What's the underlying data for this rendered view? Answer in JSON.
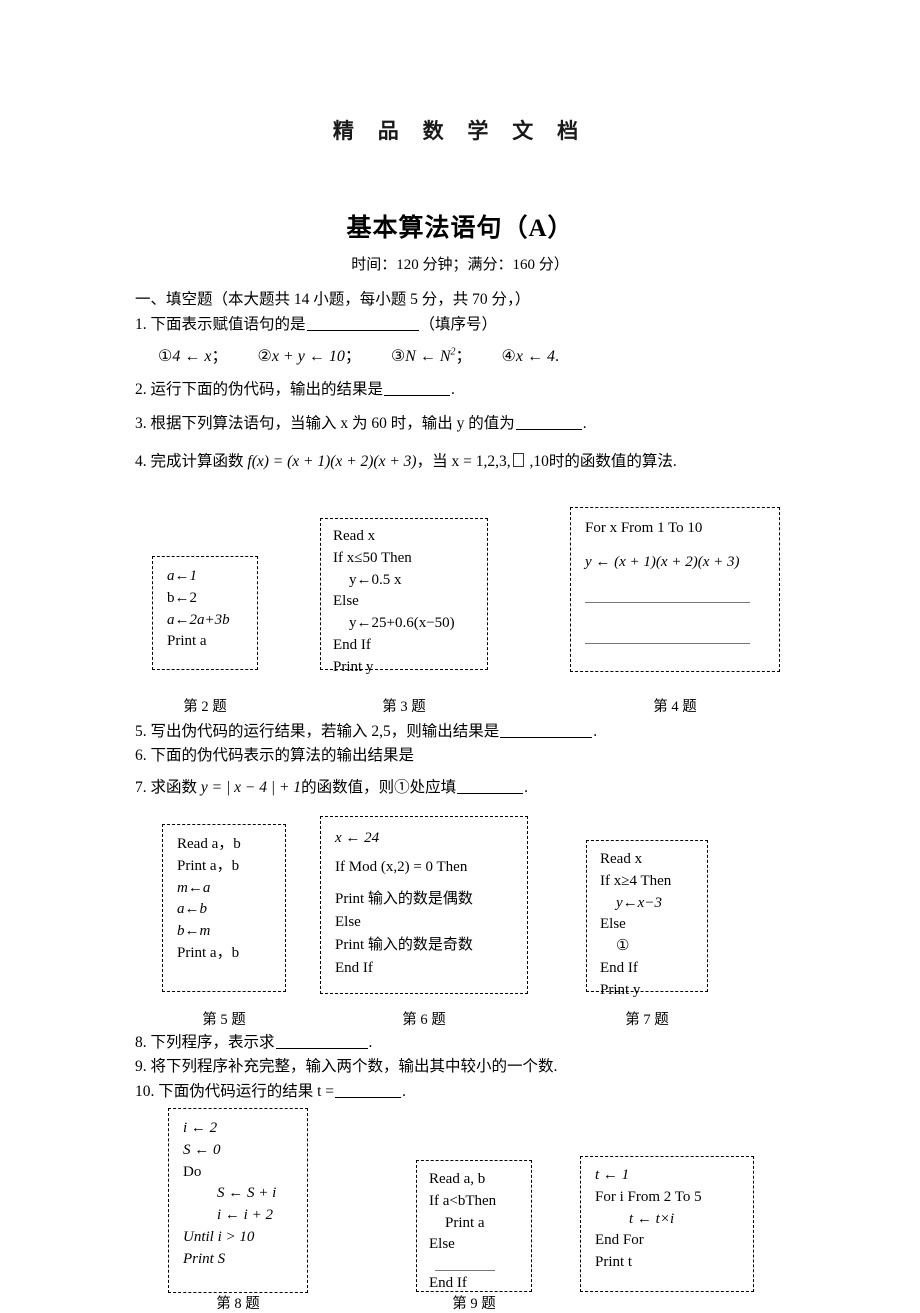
{
  "header": {
    "watermark": "精 品 数 学 文 档"
  },
  "title": {
    "main": "基本算法语句（A）",
    "subtitle": "时间：120 分钟；满分：160 分）"
  },
  "section": {
    "heading": "一、填空题（本大题共 14 小题，每小题 5 分，共 70 分，）"
  },
  "questions": {
    "q1": {
      "text": "1. 下面表示赋值语句的是",
      "suffix": "（填序号）",
      "options": [
        {
          "marker": "①",
          "expr": "4 ← x",
          "tail": "；"
        },
        {
          "marker": "②",
          "expr": "x + y ← 10",
          "tail": "；"
        },
        {
          "marker": "③",
          "expr": "N ← N",
          "sup": "2",
          "tail": "；"
        },
        {
          "marker": "④",
          "expr": "x ← 4",
          "tail": "."
        }
      ]
    },
    "q2": {
      "text": "2. 运行下面的伪代码，输出的结果是",
      "tail": "."
    },
    "q3": {
      "text": "3. 根据下列算法语句，当输入 x 为 60 时，输出 y 的值为",
      "tail": "."
    },
    "q4": {
      "prefix": "4. 完成计算函数 ",
      "func": "f(x) = (x + 1)(x + 2)(x + 3)",
      "mid": "，当 x = 1,2,3,",
      "tail": " ,10时的函数值的算法."
    },
    "q5": {
      "text": "5. 写出伪代码的运行结果，若输入 2,5，则输出结果是",
      "tail": "."
    },
    "q6": {
      "text": "6. 下面的伪代码表示的算法的输出结果是"
    },
    "q7": {
      "prefix": "7. 求函数 ",
      "func": "y = | x − 4 | + 1",
      "mid": "的函数值，则①处应填",
      "tail": "."
    },
    "q8": {
      "text": "8. 下列程序，表示求",
      "tail": "."
    },
    "q9": {
      "text": "9. 将下列程序补充完整，输入两个数，输出其中较小的一个数."
    },
    "q10": {
      "prefix": "10. 下面伪代码运行的结果 t =",
      "tail": "."
    }
  },
  "code_boxes": {
    "box2": {
      "caption": "第 2 题",
      "lines": [
        "a←1",
        "b←2",
        "a←2a+3b",
        "Print a"
      ]
    },
    "box3": {
      "caption": "第 3 题",
      "lines": [
        "Read   x",
        "If x≤50 Then",
        "y←0.5 x",
        "Else",
        "y←25+0.6(x−50)",
        "End   If",
        "Print   y"
      ]
    },
    "box4": {
      "caption": "第 4 题",
      "lines": [
        "For   x   From 1 To 10",
        "y ← (x + 1)(x + 2)(x + 3)"
      ]
    },
    "box5": {
      "caption": "第 5 题",
      "lines": [
        "Read   a，b",
        "Print   a，b",
        "m←a",
        "a←b",
        "b←m",
        "Print   a，b"
      ]
    },
    "box6": {
      "caption": "第 6 题",
      "lines": [
        "x ← 24",
        "If Mod  (x,2) = 0   Then",
        "Print 输入的数是偶数",
        "Else",
        "Print 输入的数是奇数",
        "End If"
      ]
    },
    "box7": {
      "caption": "第 7 题",
      "lines": [
        "Read   x",
        "If x≥4 Then",
        "y←x−3",
        "Else",
        "①",
        "End   If",
        "Print   y"
      ]
    },
    "box8": {
      "caption": "第 8 题",
      "lines": [
        "i ← 2",
        "S ← 0",
        "Do",
        "S ← S + i",
        "i ← i + 2",
        "Until  i > 10",
        "Print  S"
      ]
    },
    "box9": {
      "caption": "第 9 题",
      "lines": [
        "Read   a, b",
        "If a<bThen",
        "Print   a",
        "Else",
        "End   If"
      ]
    },
    "box10": {
      "lines": [
        "t ← 1",
        "For   i   From 2 To 5",
        "t ← t×i",
        "End For",
        "Print  t"
      ]
    }
  }
}
